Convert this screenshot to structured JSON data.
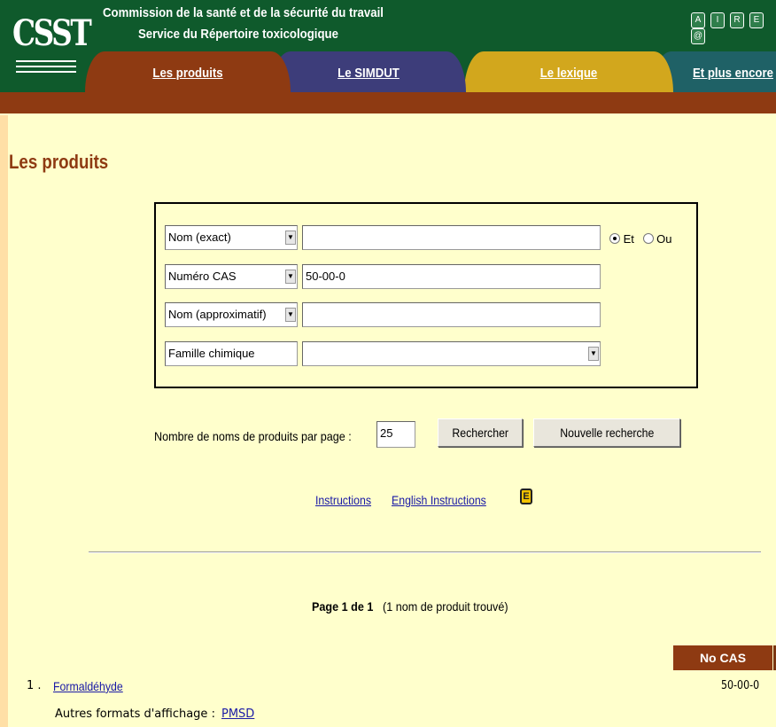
{
  "header": {
    "logo_text": "CSST",
    "org_line1": "Commission de la santé et de la sécurité du travail",
    "org_line2": "Service du Répertoire toxicologique",
    "tools": [
      "A",
      "I",
      "R",
      "E",
      "@"
    ],
    "tabs": [
      {
        "label": "Les produits",
        "color": "#8e3a12"
      },
      {
        "label": "Le SIMDUT",
        "color": "#3d3d7a"
      },
      {
        "label": "Le lexique",
        "color": "#d2a71d"
      },
      {
        "label": "Et plus encore",
        "color": "#1f6166"
      }
    ]
  },
  "page_title": "Les produits",
  "search": {
    "rows": [
      {
        "type_label": "Nom (exact)",
        "value": ""
      },
      {
        "type_label": "Numéro CAS",
        "value": "50-00-0"
      },
      {
        "type_label": "Nom (approximatif)",
        "value": ""
      },
      {
        "type_label": "Famille chimique",
        "value": ""
      }
    ],
    "condition": {
      "options": [
        "Et",
        "Ou"
      ],
      "selected": "Et"
    },
    "per_page_label": "Nombre de noms de produits par page :",
    "per_page_value": "25",
    "search_button": "Rechercher",
    "new_search_button": "Nouvelle recherche"
  },
  "links": {
    "instructions": "Instructions",
    "english_instructions": "English Instructions",
    "e_icon": "E"
  },
  "pagination": {
    "page_label": "Page 1 de 1",
    "found": "(1 nom de produit trouvé)"
  },
  "results": {
    "cas_header": "No CAS",
    "items": [
      {
        "number": "1 .",
        "name": "Formaldéhyde",
        "cas": "50-00-0",
        "other_formats_label": "Autres formats d'affichage :",
        "other_formats_link": "PMSD"
      }
    ]
  },
  "colors": {
    "page_bg": "#ffffcc",
    "header_green": "#0f5a2c",
    "accent_brown": "#8e3a12",
    "link_blue": "#1a1aa6"
  }
}
